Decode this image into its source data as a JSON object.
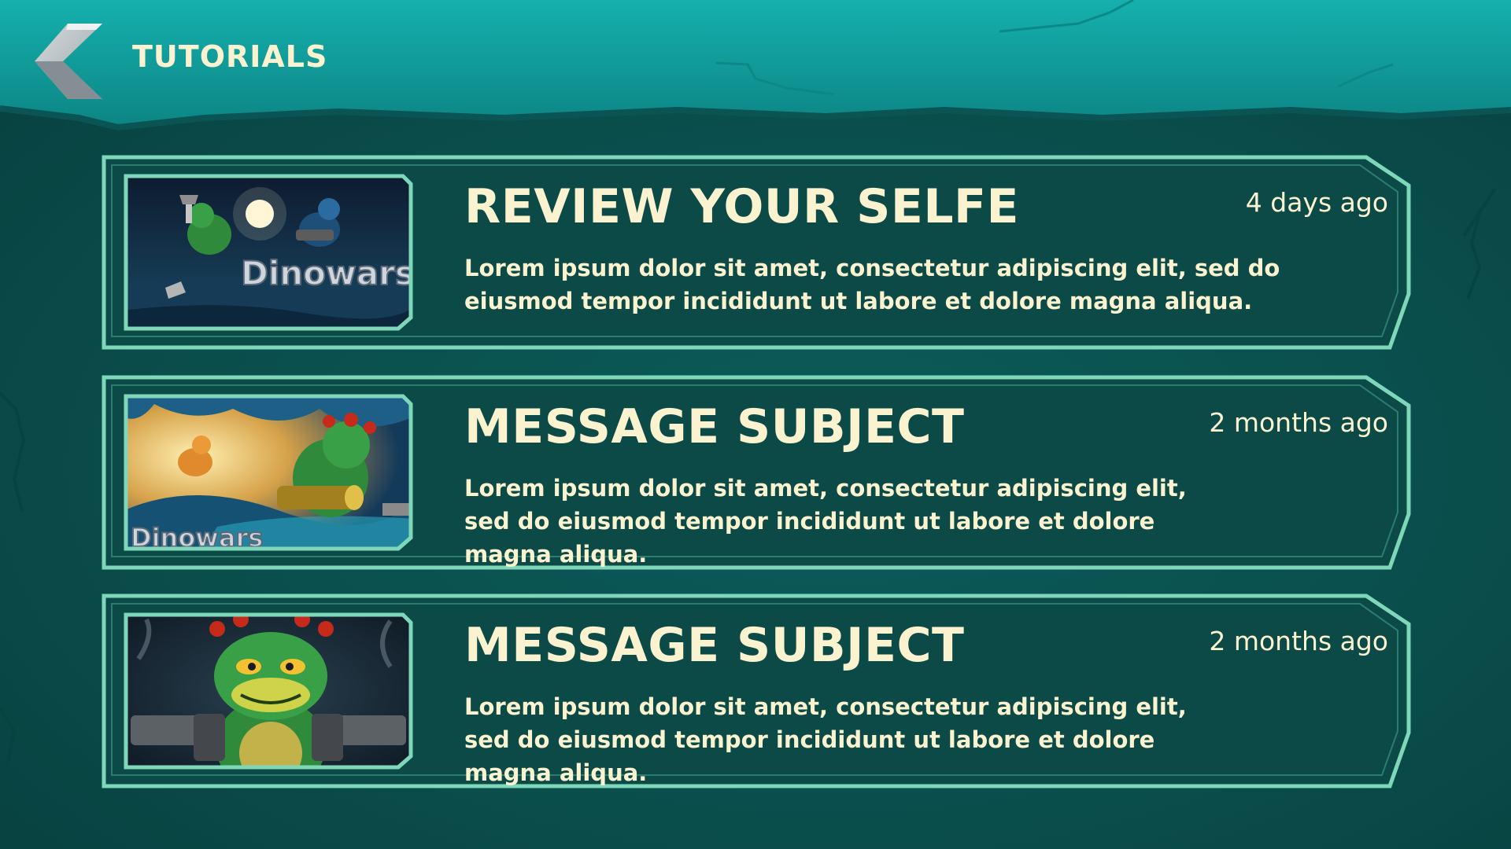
{
  "header": {
    "title": "TUTORIALS",
    "back_icon": "chevron-left-icon"
  },
  "colors": {
    "header_teal": "#16aaa8",
    "background": "#0a4e4c",
    "card_fill": "#0d4b49",
    "card_border": "#7fd7b9",
    "text_cream": "#fbf3cf"
  },
  "messages": [
    {
      "title": "REVIEW YOUR SELFE",
      "time": "4 days ago",
      "body": "Lorem ipsum dolor sit amet, consectetur adipiscing elit, sed do eiusmod tempor incididunt ut labore et dolore magna aliqua.",
      "thumbnail_label": "Dinowars",
      "thumbnail_scene": "night-battle-moon"
    },
    {
      "title": "MESSAGE SUBJECT",
      "time": "2 months ago",
      "body": "Lorem ipsum dolor sit amet, consectetur adipiscing elit, sed do eiusmod tempor incididunt ut labore et dolore magna aliqua.",
      "thumbnail_label": "Dinowars",
      "thumbnail_scene": "cave-bazooka"
    },
    {
      "title": "MESSAGE SUBJECT",
      "time": "2 months ago",
      "body": "Lorem ipsum dolor sit amet, consectetur adipiscing elit, sed do eiusmod tempor incididunt ut labore et dolore magna aliqua.",
      "thumbnail_scene": "dino-with-pistols"
    }
  ]
}
